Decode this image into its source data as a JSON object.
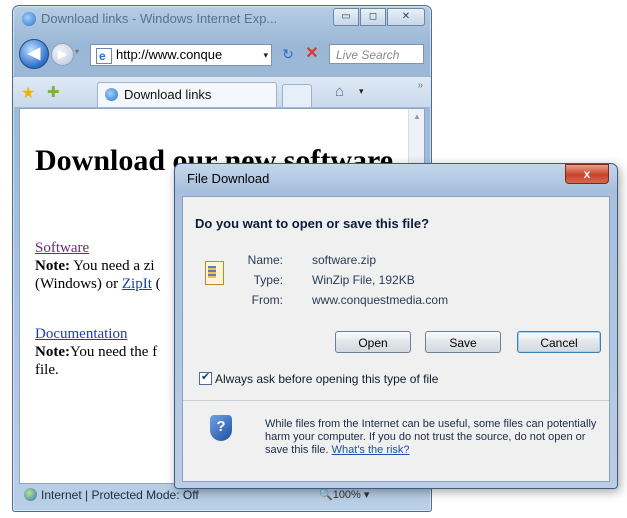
{
  "browser": {
    "title": "Download links - Windows Internet Exp...",
    "window_buttons": {
      "minimize": "▭",
      "maximize": "◻",
      "close": "✕"
    },
    "nav": {
      "back_icon": "◀",
      "forward_icon": "▶",
      "history_icon": "▾"
    },
    "address": {
      "value": "http://www.conque",
      "dropdown": "▾"
    },
    "refresh_icon": "↻",
    "stop_icon": "✕",
    "search_placeholder": "Live Search",
    "tab": {
      "label": "Download links"
    },
    "home_icon": "⌂",
    "home_dropdown": "▾",
    "overflow_icon": "»",
    "status": {
      "zone": "Internet | Protected Mode: Off",
      "zoom": "🔍100%  ▾"
    }
  },
  "page": {
    "heading": "Download our new software",
    "software_link": "Software",
    "note1_label": "Note:",
    "note1_text": " You need a zi",
    "note1_line2_a": "(Windows) or ",
    "note1_link": "ZipIt",
    "note1_line2_b": " (",
    "doc_link": "Documentation",
    "note2_label": "Note:",
    "note2_text": "You need the f",
    "note2_line2": "file."
  },
  "dialog": {
    "title": "File Download",
    "close_label": "x",
    "question": "Do you want to open or save this file?",
    "info": [
      {
        "key": "Name:",
        "value": "software.zip"
      },
      {
        "key": "Type:",
        "value": "WinZip File, 192KB"
      },
      {
        "key": "From:",
        "value": "www.conquestmedia.com"
      }
    ],
    "buttons": {
      "open": "Open",
      "save": "Save",
      "cancel": "Cancel"
    },
    "checkbox": {
      "label": "Always ask before opening this type of file",
      "checked": true
    },
    "warning": "While files from the Internet can be useful, some files can potentially harm your computer. If you do not trust the source, do not open or save this file. ",
    "risk_link": "What's the risk?"
  }
}
